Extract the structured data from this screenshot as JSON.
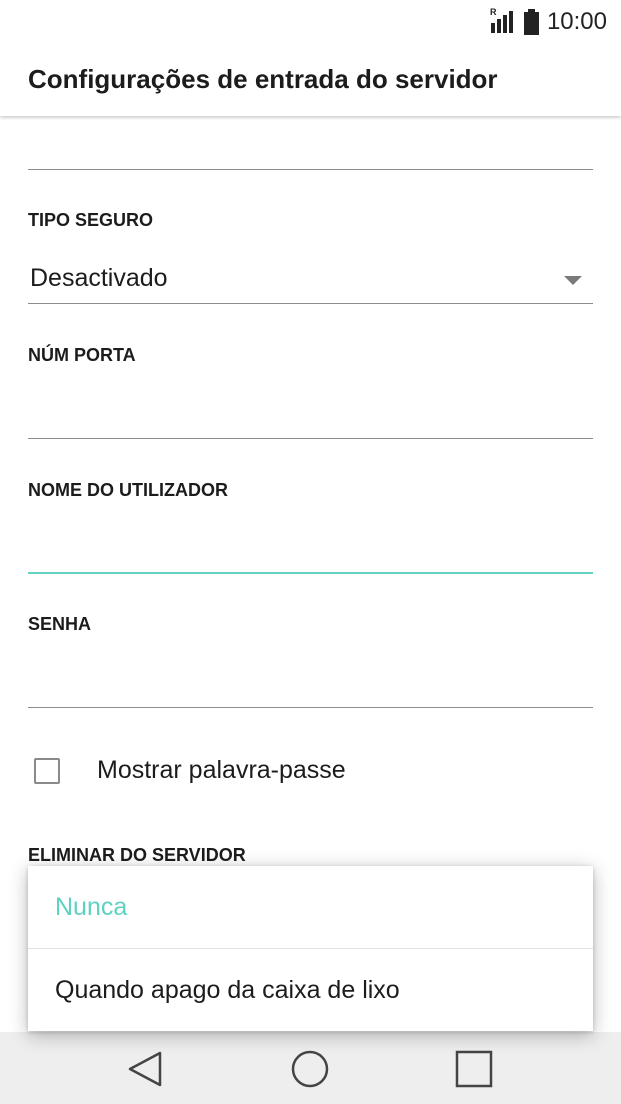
{
  "status_bar": {
    "roaming_indicator": "R",
    "time": "10:00",
    "icons": [
      "signal-icon",
      "battery-icon"
    ]
  },
  "app_bar": {
    "title": "Configurações de entrada do servidor"
  },
  "form": {
    "security_type": {
      "label": "TIPO SEGURO",
      "value": "Desactivado"
    },
    "port": {
      "label": "NÚM PORTA",
      "value": ""
    },
    "username": {
      "label": "NOME DO UTILIZADOR",
      "value": ""
    },
    "password": {
      "label": "SENHA",
      "value": ""
    },
    "show_password": {
      "label": "Mostrar palavra-passe",
      "checked": false
    },
    "delete_from_server": {
      "label": "ELIMINAR DO SERVIDOR"
    }
  },
  "popup": {
    "options": [
      {
        "label": "Nunca",
        "selected": true
      },
      {
        "label": "Quando apago da caixa de lixo",
        "selected": false
      }
    ]
  },
  "nav_bar": {
    "icons": [
      "back-icon",
      "home-icon",
      "recents-icon"
    ]
  },
  "colors": {
    "accent": "#5fd1c0",
    "divider": "#8c8c8c",
    "nav_background": "#eeeeee"
  }
}
